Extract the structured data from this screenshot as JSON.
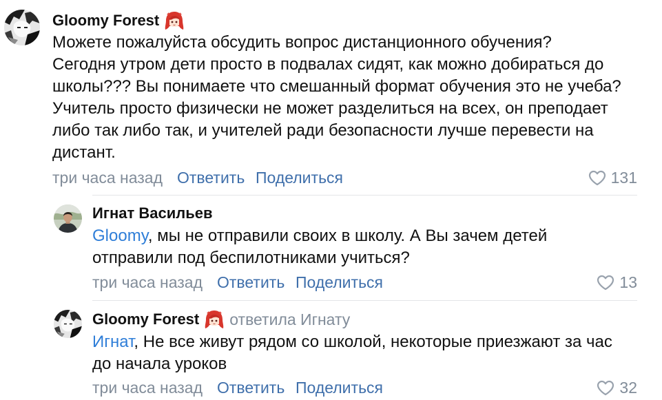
{
  "thread": {
    "comment": {
      "author": "Gloomy Forest",
      "avatar_icon": "gloomy-forest-avatar",
      "author_emoji_icon": "red-haired-girl-emoji",
      "text_lines": [
        "Можете пожалуйста обсудить вопрос дистанционного обучения?",
        "Сегодня утром дети просто в подвалах сидят, как можно добираться до",
        "школы??? Вы понимаете что смешанный формат обучения это не учеба?",
        "Учитель просто физически не может разделиться на всех, он преподает",
        "либо так либо так, и учителей ради безопасности лучше перевести на",
        "дистант."
      ],
      "time": "три часа назад",
      "reply_label": "Ответить",
      "share_label": "Поделиться",
      "like_icon": "heart-outline-icon",
      "likes": "131"
    },
    "replies": [
      {
        "author": "Игнат Васильев",
        "avatar_icon": "ignat-vasilyev-avatar",
        "mention": "Gloomy",
        "text_lines": [
          ", мы не отправили своих в школу. А Вы зачем детей",
          "отправили под беспилотниками учиться?"
        ],
        "time": "три часа назад",
        "reply_label": "Ответить",
        "share_label": "Поделиться",
        "like_icon": "heart-outline-icon",
        "likes": "13"
      },
      {
        "author": "Gloomy Forest",
        "avatar_icon": "gloomy-forest-avatar",
        "author_emoji_icon": "red-haired-girl-emoji",
        "reply_to": "ответила Игнату",
        "mention": "Игнат",
        "text_lines": [
          ", Не все живут рядом со школой, некоторые приезжают за час",
          "до начала уроков"
        ],
        "time": "три часа назад",
        "reply_label": "Ответить",
        "share_label": "Поделиться",
        "like_icon": "heart-outline-icon",
        "likes": "32"
      }
    ]
  },
  "colors": {
    "text": "#111111",
    "secondary_text": "#818c99",
    "link": "#3f6fab",
    "mention": "#2f7ed8",
    "icon": "#99a2ad",
    "separator": "#e3e5e8",
    "background": "#ffffff"
  }
}
